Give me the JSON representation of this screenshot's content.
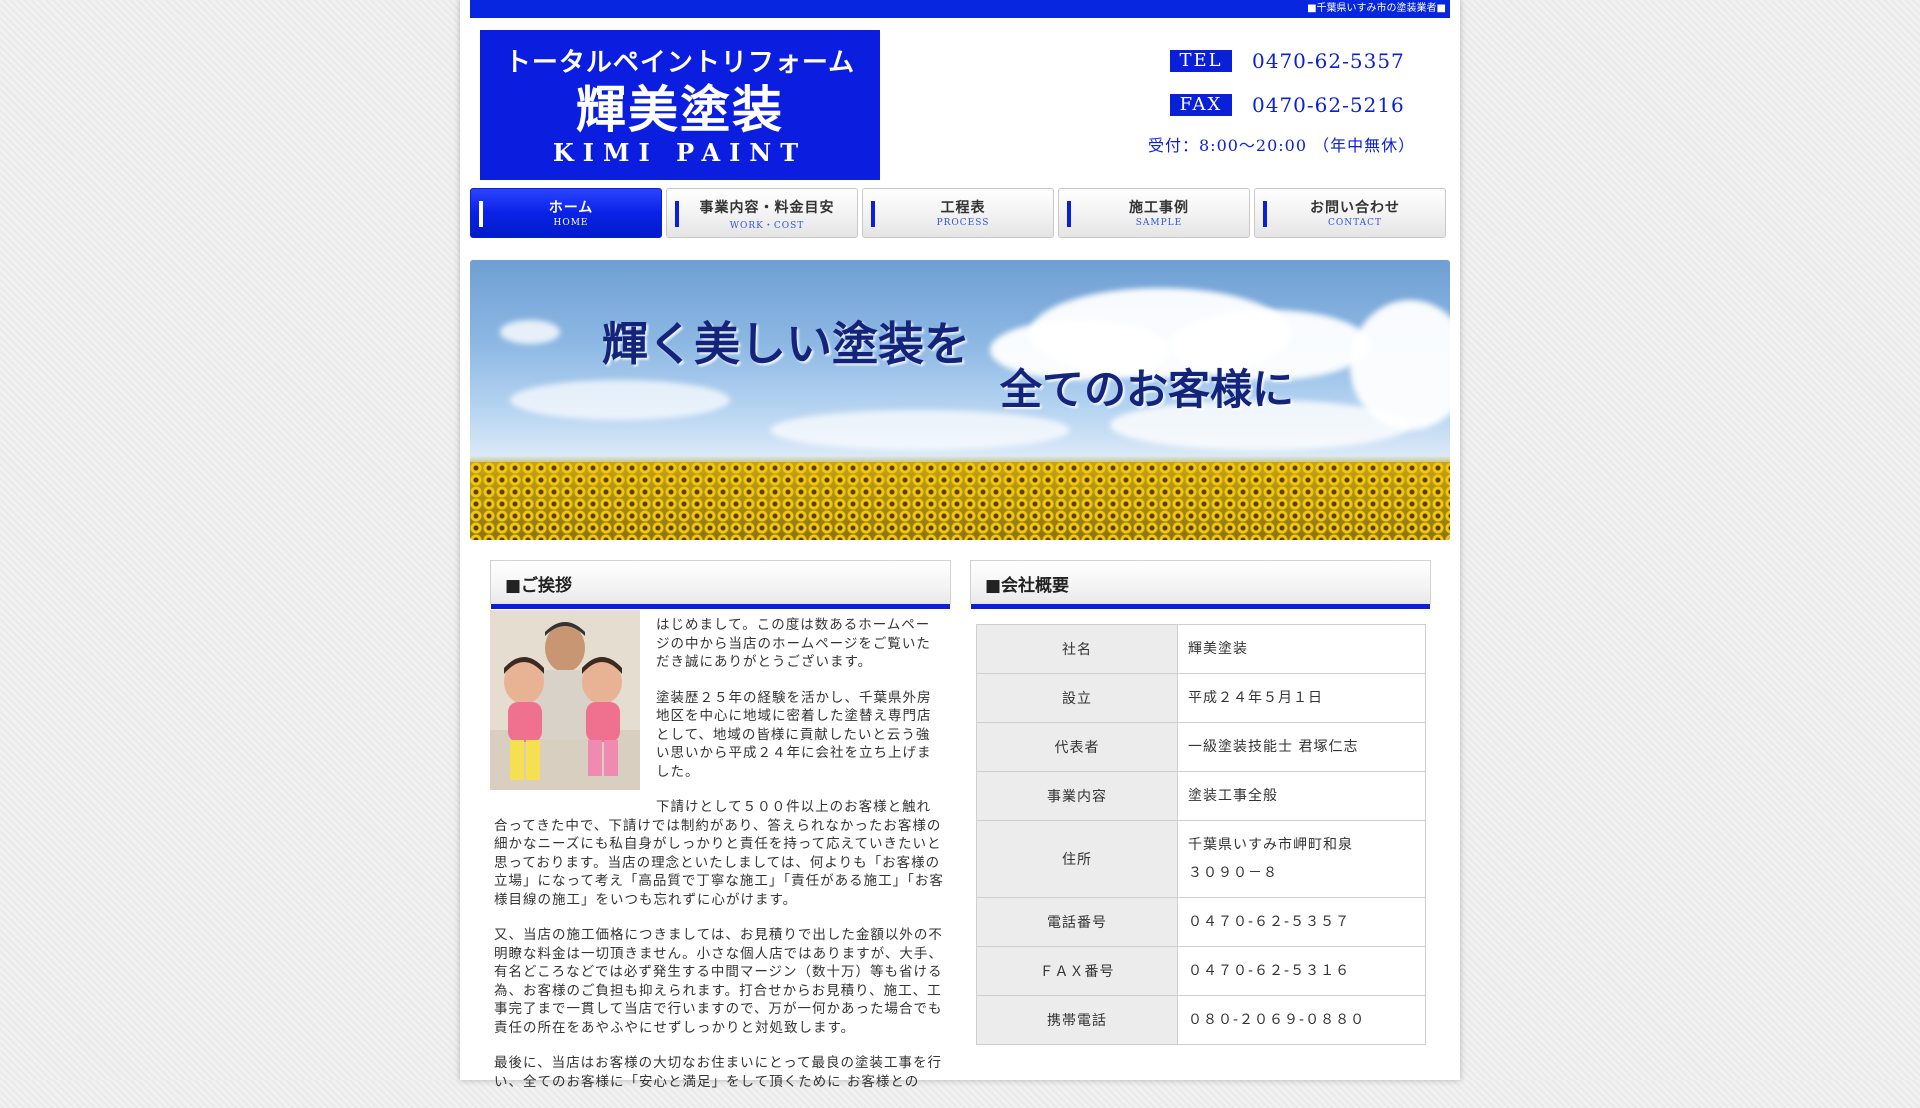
{
  "topbar": {
    "text": "■千葉県いすみ市の塗装業者■"
  },
  "logo": {
    "line1": "トータルペイントリフォーム",
    "line2": "輝美塗装",
    "line3": "KIMI PAINT"
  },
  "contact": {
    "tel_label": "TEL",
    "tel_number": "0470-62-5357",
    "fax_label": "FAX",
    "fax_number": "0470-62-5216",
    "hours": "受付：8:00～20:00 （年中無休）"
  },
  "nav": {
    "items": [
      {
        "jp": "ホーム",
        "en": "HOME"
      },
      {
        "jp": "事業内容・料金目安",
        "en": "WORK・COST"
      },
      {
        "jp": "工程表",
        "en": "PROCESS"
      },
      {
        "jp": "施工事例",
        "en": "SAMPLE"
      },
      {
        "jp": "お問い合わせ",
        "en": "CONTACT"
      }
    ]
  },
  "hero": {
    "slogan1": "輝く美しい塗装を",
    "slogan2": "全てのお客様に"
  },
  "greeting": {
    "heading": "■ご挨拶",
    "paragraphs": [
      "はじめまして。この度は数あるホームページの中から当店のホームページをご覧いただき誠にありがとうございます。",
      "塗装歴２５年の経験を活かし、千葉県外房地区を中心に地域に密着した塗替え専門店として、地域の皆様に貢献したいと云う強い思いから平成２４年に会社を立ち上げました。",
      "下請けとして５００件以上のお客様と触れ合ってきた中で、下請けでは制約があり、答えられなかったお客様の細かなニーズにも私自身がしっかりと責任を持って応えていきたいと思っております。当店の理念といたしましては、何よりも「お客様の立場」になって考え「高品質で丁寧な施工」「責任がある施工」「お客様目線の施工」をいつも忘れずに心がけます。",
      "又、当店の施工価格につきましては、お見積りで出した金額以外の不明瞭な料金は一切頂きません。小さな個人店ではありますが、大手、有名どころなどでは必ず発生する中間マージン（数十万）等も省ける為、お客様のご負担も抑えられます。打合せからお見積り、施工、工事完了まで一貫して当店で行いますので、万が一何かあった場合でも責任の所在をあやふやにせずしっかりと対処致します。",
      "最後に、当店はお客様の大切なお住まいにとって最良の塗装工事を行い、全てのお客様に「安心と満足」をして頂くために お客様との"
    ]
  },
  "company": {
    "heading": "■会社概要",
    "rows": [
      {
        "key": "社名",
        "value": "輝美塗装"
      },
      {
        "key": "設立",
        "value": "平成２４年５月１日"
      },
      {
        "key": "代表者",
        "value": "一級塗装技能士 君塚仁志"
      },
      {
        "key": "事業内容",
        "value": "塗装工事全般"
      },
      {
        "key": "住所",
        "value": "千葉県いすみ市岬町和泉",
        "value2": "３０９０－８"
      },
      {
        "key": "電話番号",
        "value": "０４７０-６２-５３５７"
      },
      {
        "key": "ＦＡＸ番号",
        "value": "０４７０-６２-５３１６"
      },
      {
        "key": "携帯電話",
        "value": "０８０-２０６９-０８８０"
      }
    ]
  }
}
